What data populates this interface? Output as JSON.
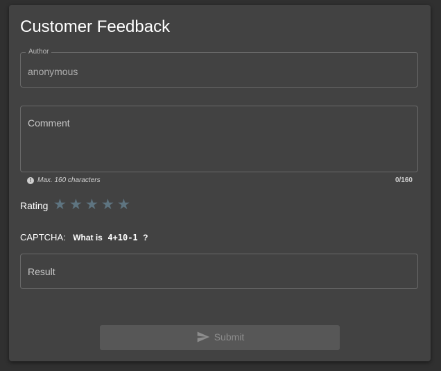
{
  "form": {
    "title": "Customer Feedback",
    "author": {
      "label": "Author",
      "value": "anonymous"
    },
    "comment": {
      "placeholder": "Comment",
      "hint": "Max. 160 characters",
      "counter": "0/160"
    },
    "rating": {
      "label": "Rating",
      "value": 0,
      "max": 5,
      "star_color": "#5e7480"
    },
    "captcha": {
      "label": "CAPTCHA:",
      "question_prefix": "What is",
      "expression": "4+10-1",
      "question_suffix": "?"
    },
    "result": {
      "placeholder": "Result"
    },
    "submit": {
      "label": "Submit",
      "icon": "send-icon",
      "disabled": true
    }
  },
  "colors": {
    "page_bg": "#303030",
    "card_bg": "#424242",
    "border": "#6a6a6a",
    "button_bg": "#575757"
  }
}
